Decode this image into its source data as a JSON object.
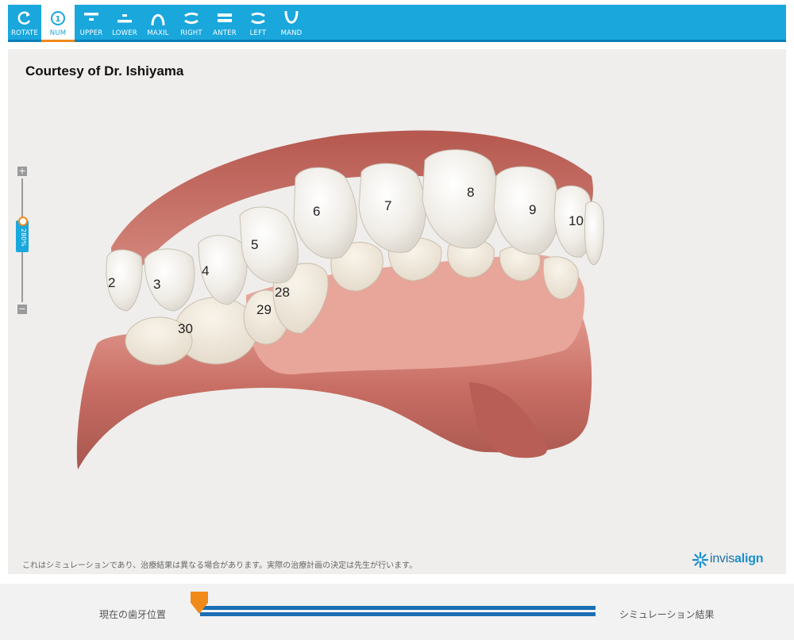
{
  "toolbar": {
    "buttons": [
      {
        "label": "ROTATE",
        "icon": "rotate-icon"
      },
      {
        "label": "NUM",
        "icon": "number-icon",
        "active": true
      },
      {
        "label": "UPPER",
        "icon": "upper-arch-icon"
      },
      {
        "label": "LOWER",
        "icon": "lower-arch-icon"
      },
      {
        "label": "MAXIL",
        "icon": "maxillary-icon"
      },
      {
        "label": "RIGHT",
        "icon": "right-view-icon"
      },
      {
        "label": "ANTER",
        "icon": "anterior-view-icon"
      },
      {
        "label": "LEFT",
        "icon": "left-view-icon"
      },
      {
        "label": "MAND",
        "icon": "mandibular-icon"
      }
    ],
    "num_glyph": "1",
    "colors": {
      "bar": "#19a7dc",
      "accent": "#f08a1a"
    }
  },
  "viewer": {
    "courtesy": "Courtesy of Dr. Ishiyama",
    "disclaimer": "これはシミュレーションであり、治療結果は異なる場合があります。実際の治療計画の決定は先生が行います。",
    "logo": {
      "prefix": "invis",
      "suffix": "align"
    },
    "zoom": {
      "plus": "+",
      "minus": "−",
      "value": "280%"
    },
    "tooth_numbers": [
      "2",
      "3",
      "4",
      "5",
      "6",
      "7",
      "8",
      "9",
      "10",
      "28",
      "29",
      "30"
    ]
  },
  "timeline": {
    "current_label": "現在の歯牙位置",
    "result_label": "シミュレーション結果",
    "progress": 0
  }
}
